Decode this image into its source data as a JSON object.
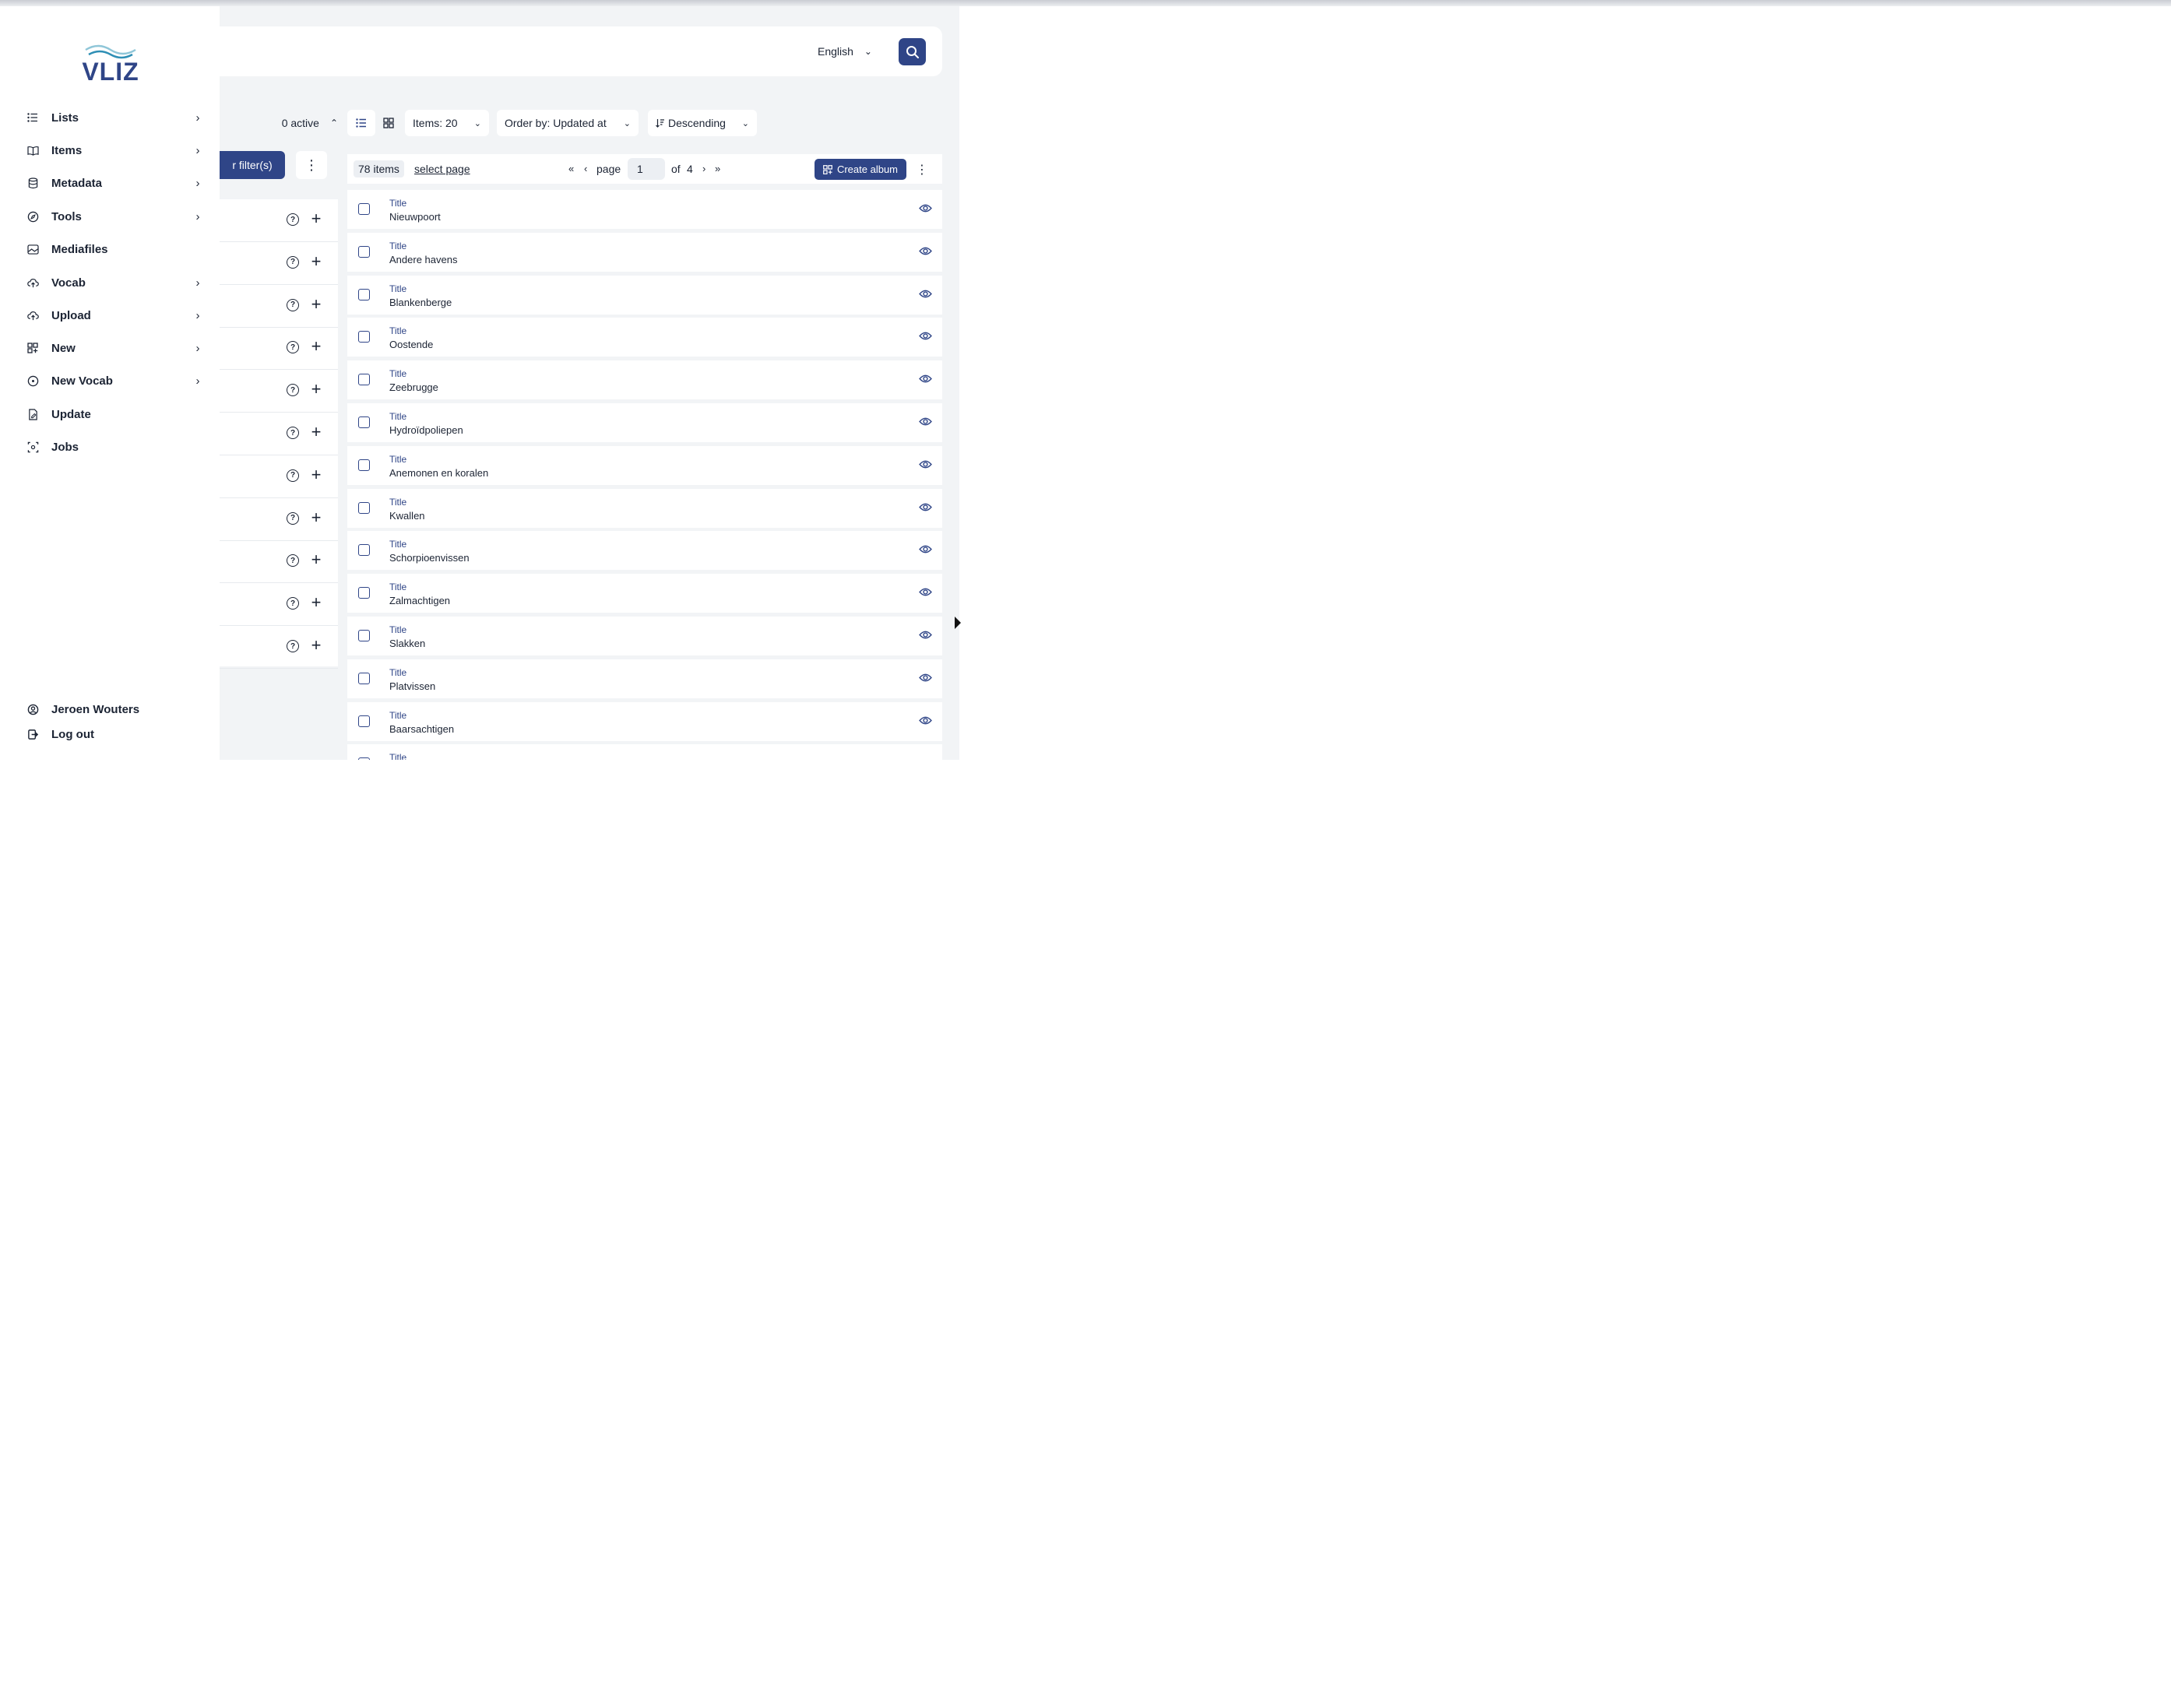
{
  "sidebar": {
    "logo": "VLIZ",
    "items": [
      {
        "label": "Lists",
        "icon": "list-icon",
        "chevron": true
      },
      {
        "label": "Items",
        "icon": "book-icon",
        "chevron": true
      },
      {
        "label": "Metadata",
        "icon": "database-icon",
        "chevron": true
      },
      {
        "label": "Tools",
        "icon": "compass-icon",
        "chevron": true
      },
      {
        "label": "Mediafiles",
        "icon": "image-icon",
        "chevron": false
      },
      {
        "label": "Vocab",
        "icon": "cloud-upload-icon",
        "chevron": true
      },
      {
        "label": "Upload",
        "icon": "upload-icon",
        "chevron": true
      },
      {
        "label": "New",
        "icon": "grid-plus-icon",
        "chevron": true
      },
      {
        "label": "New Vocab",
        "icon": "plus-circle-icon",
        "chevron": true
      },
      {
        "label": "Update",
        "icon": "file-edit-icon",
        "chevron": false
      },
      {
        "label": "Jobs",
        "icon": "loader-icon",
        "chevron": false
      }
    ],
    "user": "Jeroen Wouters",
    "logout": "Log out"
  },
  "header": {
    "language": "English"
  },
  "filters": {
    "active_label": "0 active",
    "apply_label": "r filter(s)",
    "rows": 11
  },
  "toolbar": {
    "items_per_page": "Items: 20",
    "order_by": "Order by: Updated at",
    "direction": "Descending"
  },
  "listbar": {
    "count": "78 items",
    "select_page": "select page",
    "page_label": "page",
    "page_value": "1",
    "of_label": "of",
    "total_pages": "4",
    "create_album": "Create album"
  },
  "list": {
    "field_label": "Title",
    "items": [
      "Nieuwpoort",
      "Andere havens",
      "Blankenberge",
      "Oostende",
      "Zeebrugge",
      "Hydroïdpoliepen",
      "Anemonen en koralen",
      "Kwallen",
      "Schorpioenvissen",
      "Zalmachtigen",
      "Slakken",
      "Platvissen",
      "Baarsachtigen",
      ""
    ]
  },
  "colors": {
    "accent": "#2f4587",
    "background": "#f2f4f6",
    "text": "#1c2434"
  }
}
